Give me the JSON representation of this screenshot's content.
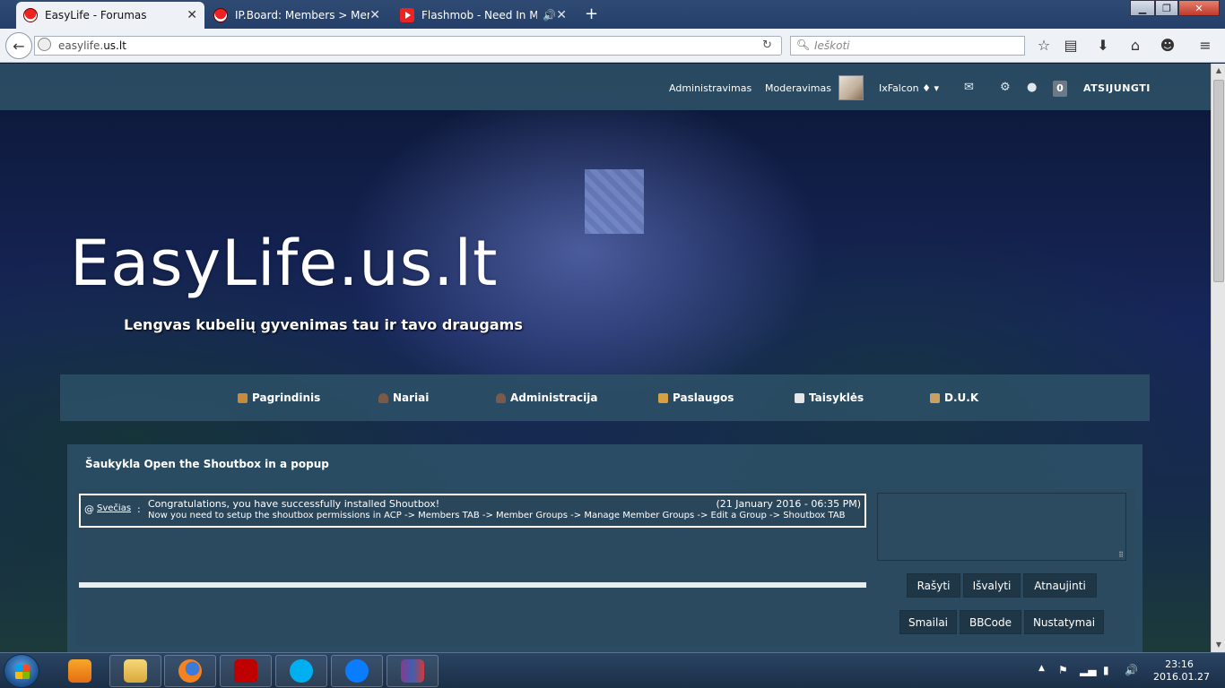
{
  "browser": {
    "tabs": [
      {
        "title": "EasyLife - Forumas",
        "active": true
      },
      {
        "title": "IP.Board: Members > Mem...",
        "active": false
      },
      {
        "title": "Flashmob - Need In M...",
        "active": false
      }
    ],
    "url_prefix": "easylife.",
    "url_host": "us.lt",
    "search_placeholder": "Ieškoti"
  },
  "userbar": {
    "admin_link": "Administravimas",
    "mod_link": "Moderavimas",
    "username": "IxFalcon ♦ ▾",
    "notification_count": "0",
    "logout": "ATSIJUNGTI"
  },
  "header": {
    "logo": "EasyLife.us.lt",
    "tagline": "Lengvas kubelių gyvenimas tau ir tavo draugams"
  },
  "nav": {
    "items": [
      {
        "label": "Pagrindinis",
        "icon": "home-icon"
      },
      {
        "label": "Nariai",
        "icon": "user-icon"
      },
      {
        "label": "Administracija",
        "icon": "admin-icon"
      },
      {
        "label": "Paslaugos",
        "icon": "services-icon"
      },
      {
        "label": "Taisyklės",
        "icon": "rules-icon"
      },
      {
        "label": "D.U.K",
        "icon": "faq-icon"
      }
    ]
  },
  "shoutbox": {
    "title": "Šaukykla Open the Shoutbox in a popup",
    "message": {
      "at": "@",
      "user": "Svečias",
      "colon": ":",
      "line1": "Congratulations, you have successfully installed Shoutbox!",
      "line2": "Now you need to setup the shoutbox permissions in ACP -> Members TAB -> Member Groups -> Manage Member Groups -> Edit a Group -> Shoutbox TAB",
      "time": "(21 January 2016 - 06:35 PM)"
    },
    "buttons": {
      "write": "Rašyti",
      "clear": "Išvalyti",
      "refresh": "Atnaujinti",
      "smilies": "Smailai",
      "bbcode": "BBCode",
      "settings": "Nustatymai"
    }
  },
  "taskbar": {
    "time": "23:16",
    "date": "2016.01.27"
  },
  "colors": {
    "panel": "#2b4e65",
    "button": "#1e3646",
    "tabbar": "#2f4a73"
  }
}
